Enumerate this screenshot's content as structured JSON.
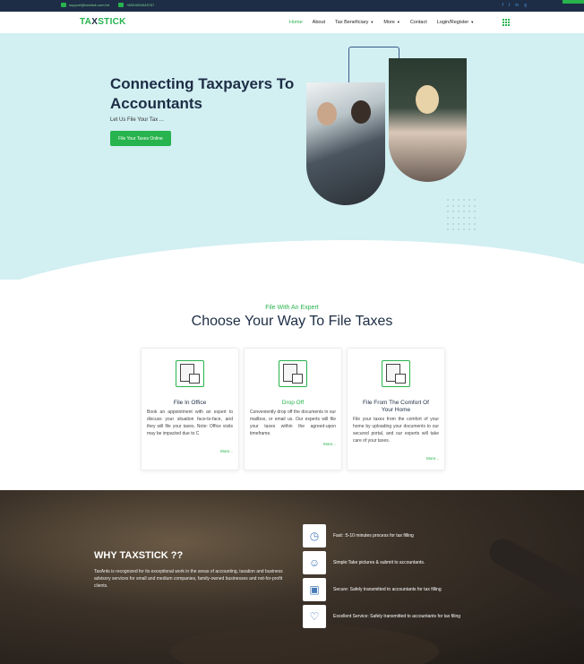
{
  "topbar": {
    "email": "support@taxstick.com.bd",
    "phone": "+8801894943767",
    "social": [
      "f",
      "t",
      "in",
      "g"
    ]
  },
  "nav": {
    "logo_main": "TA",
    "logo_x": "X",
    "logo_rest": "STICK",
    "items": [
      {
        "label": "Home",
        "active": true
      },
      {
        "label": "About"
      },
      {
        "label": "Tax Beneficiary",
        "caret": "▼"
      },
      {
        "label": "More",
        "caret": "▼"
      },
      {
        "label": "Contact"
      },
      {
        "label": "Login/Register",
        "caret": "▼"
      }
    ]
  },
  "hero": {
    "title": "Connecting Taxpayers To Accountants",
    "subtitle": "Let Us File Your Tax ...",
    "cta": "File Your Taxes Online"
  },
  "choose": {
    "kicker": "File With An Expert",
    "title": "Choose Your Way To File Taxes",
    "cards": [
      {
        "title": "File In Office",
        "text": "Book an appointment with an expert to discuss your situation face-to-face, and they will file your taxes. Note: Office visits may be impacted due to C",
        "more": "More..."
      },
      {
        "title": "Drop Off",
        "text": "Conveniently drop off the documents in our mailbox, or email us. Our experts will file your taxes within the agreed-upon timeframe.",
        "more": "More..."
      },
      {
        "title": "File From The Comfort Of Your Home",
        "text": "File your taxes from the comfort of your home by uploading your documents to our secured portal, and our experts will take care of your taxes.",
        "more": "More..."
      }
    ]
  },
  "why": {
    "title": "WHY TAXSTICK ??",
    "desc": "TaxAnts is recognized for its exceptional work in the areas of accounting, taxation and business advisory services for small and medium companies, family-owned businesses and not-for-profit clients.",
    "features": [
      {
        "icon": "clock-icon",
        "text": "Fast: :5-10 minutes process for tax filling"
      },
      {
        "icon": "user-icon",
        "text": "Simple:Take pictures & submit to accountants."
      },
      {
        "icon": "lock-icon",
        "text": "Secure: Safely transmitted to accountants for tax filling"
      },
      {
        "icon": "heart-icon",
        "text": "Excellent Service: Safely transmitted to accountants for tax filing"
      }
    ]
  },
  "colors": {
    "accent": "#27b34d",
    "navy": "#1d2d45",
    "hero_bg": "#d2eff2"
  }
}
